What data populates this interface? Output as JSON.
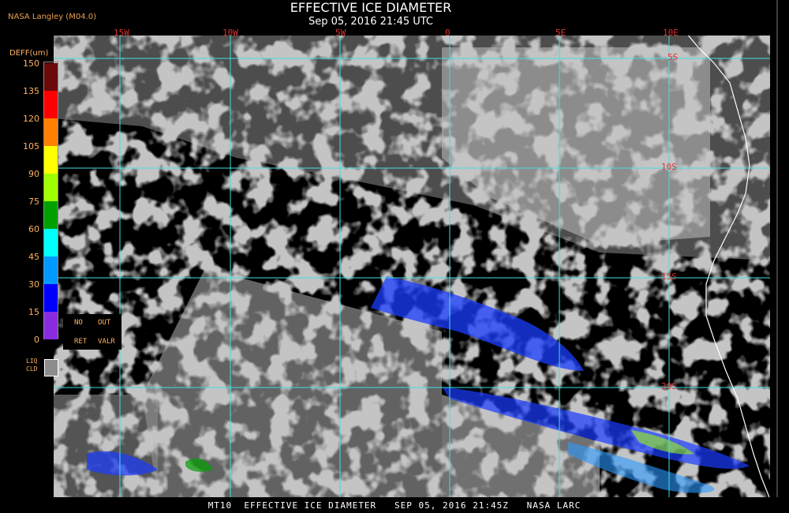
{
  "credit": "NASA Langley (M04.0)",
  "title": "EFFECTIVE ICE DIAMETER",
  "subtitle": "Sep 05, 2016 21:45 UTC",
  "legend": {
    "title": "DEFF(um)",
    "ticks": [
      "150",
      "135",
      "120",
      "105",
      "90",
      "75",
      "60",
      "45",
      "30",
      "15",
      "0"
    ],
    "colors": [
      "#6b0a0a",
      "#ff0000",
      "#ff7f00",
      "#ffff00",
      "#a0ff00",
      "#00a000",
      "#00ffff",
      "#0099ff",
      "#0000ff",
      "#8a2be2"
    ],
    "codes": {
      "no": "NO",
      "out": "OUT",
      "ret": "RET",
      "valr": "VALR"
    },
    "liq_label_1": "LIQ",
    "liq_label_2": "CLD",
    "liq_color": "#8c8c8c"
  },
  "longitudes": [
    "15W",
    "10W",
    "5W",
    "0",
    "5E",
    "10E"
  ],
  "latitudes": [
    "5S",
    "10S",
    "15S",
    "20S"
  ],
  "footer": "MT10  EFFECTIVE ICE DIAMETER   SEP 05, 2016 21:45Z   NASA LARC",
  "colors": {
    "cloud_gray": "#8c8c8c",
    "grid": "#40e0e0",
    "coastline": "#ffffff",
    "label_orange": "#ffb060",
    "grid_label_red": "#dd3333"
  }
}
